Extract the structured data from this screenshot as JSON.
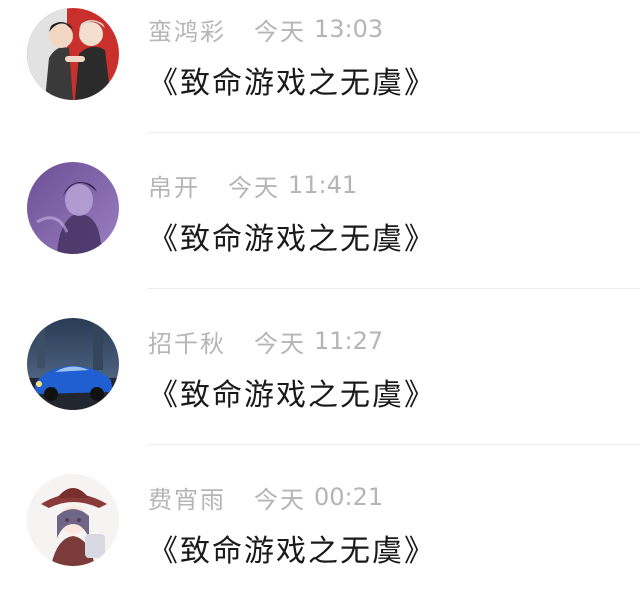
{
  "messages": [
    {
      "name": "蛮鸿彩",
      "day": "今天",
      "time": "13:03",
      "text": "《致命游戏之无虞》",
      "avatar_icon": "avatar-anime-couple-icon"
    },
    {
      "name": "帛开",
      "day": "今天",
      "time": "11:41",
      "text": "《致命游戏之无虞》",
      "avatar_icon": "avatar-purple-portrait-icon"
    },
    {
      "name": "招千秋",
      "day": "今天",
      "time": "11:27",
      "text": "《致命游戏之无虞》",
      "avatar_icon": "avatar-blue-sports-car-icon"
    },
    {
      "name": "费宵雨",
      "day": "今天",
      "time": "00:21",
      "text": "《致命游戏之无虞》",
      "avatar_icon": "avatar-anime-girl-hat-icon"
    }
  ],
  "colors": {
    "name_time": "#b5b5b5",
    "message_text": "#1a1a1a",
    "divider": "#ececec"
  }
}
